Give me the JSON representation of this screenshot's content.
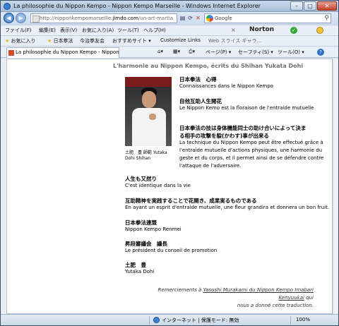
{
  "window": {
    "title": "La philosophie du Nippon Kempo - Nippon Kempo Marseille - Windows Internet Explorer",
    "controls": {
      "minimize": "–",
      "maximize": "□",
      "close": "✕"
    }
  },
  "address": {
    "prefix": "http://nipponkempomarseille.",
    "domain": "jimdo.com",
    "suffix": "/un-art-martia",
    "search_engine": "Google"
  },
  "menu": {
    "items": [
      "ファイル(F)",
      "編集(E)",
      "表示(V)",
      "お気に入り(A)",
      "ツール(T)",
      "ヘルプ(H)"
    ],
    "norton": "Norton",
    "norton_close": "×"
  },
  "favorites": {
    "label": "お気に入り",
    "items": [
      "日本拳法",
      "今治拳友会",
      "おすすめサイト ▾",
      "Customize Links",
      "Web スライス ギャラ..."
    ]
  },
  "tabs": {
    "active": "La philosophie du Nippon Kempo - Nippon K...",
    "page_menu": "ページ(P) ▾",
    "safety_menu": "セーフティ(S) ▾",
    "tools_menu": "ツール(O) ▾",
    "help_icon": "?"
  },
  "article": {
    "heading": "L'harmonie au Nippon Kempo, écrits du Shihan Yukata Dohi",
    "caption_line1": "土肥　豊 師範  Yutaka",
    "caption_line2": "Dohi Shihan",
    "sections": [
      {
        "jp": "日本拳法　心得",
        "fr": [
          "Connaissances dans le Nippon Kempo"
        ]
      },
      {
        "jp": "自他互助人生開花",
        "fr": [
          "Le Nippon Kemo est la floraison de l'entraide mutuelle"
        ]
      },
      {
        "jp": "日本拳法の技は身体機能同士の助け合いによって決ま",
        "jp2": "る相手の攻撃を躱(かわす)事が出来る",
        "fr": [
          "La technique du Nippon Kempo peut être effectué grâce à",
          "l'entraide mutuelle d'actions physiques, une harmonie du",
          "geste et du corps, et il permet ainsi de se défendre contre",
          "l'attaque de l'adversaire."
        ]
      },
      {
        "jp": "人生も又然り",
        "fr": [
          "C'est identique dans la vie"
        ]
      },
      {
        "jp": "互助精神を実践することで花開き、成果実るものである",
        "fr": [
          "En ayant un esprit d'entraide mutuelle, une fleur grandira et donnera un bon fruit."
        ]
      },
      {
        "jp": "日本拳法連盟",
        "fr": [
          "Nippon Kempo Renmei"
        ]
      },
      {
        "jp": "昇段審議会　議長",
        "fr": [
          "Le président du conseil de promotion"
        ]
      },
      {
        "jp": "土肥　豊",
        "fr": [
          "Yutaka Dohi"
        ]
      }
    ],
    "credit_prefix": "Remerciements à ",
    "credit_link": "Yasushi Murakami du Nippon Kempo Imabari Kenyuukai",
    "credit_suffix": " qui",
    "credit_line2": "nous a donné cette traduction."
  },
  "status": {
    "zone": "インターネット | 保護モード: 無効",
    "zoom": "100%"
  }
}
